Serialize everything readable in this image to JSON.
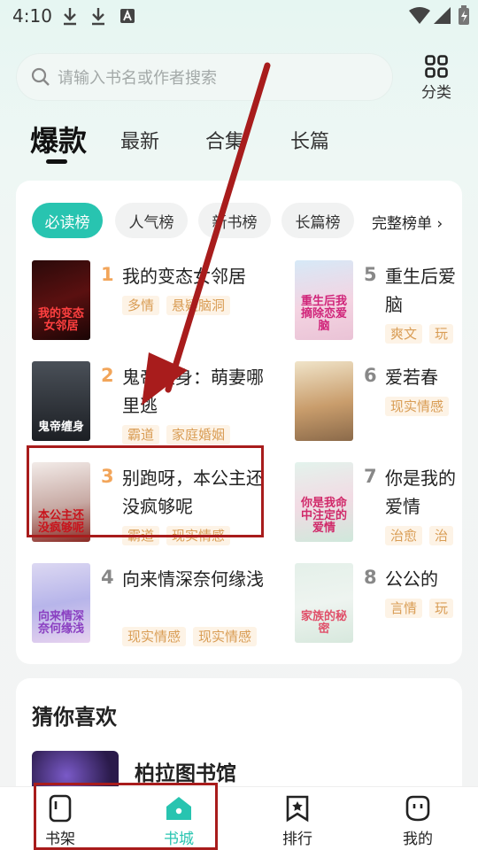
{
  "status_bar": {
    "time": "4:10"
  },
  "search": {
    "placeholder": "请输入书名或作者搜索"
  },
  "category": {
    "label": "分类"
  },
  "tabs": [
    {
      "label": "爆款",
      "active": true
    },
    {
      "label": "最新"
    },
    {
      "label": "合集"
    },
    {
      "label": "长篇"
    }
  ],
  "rank_chips": [
    {
      "label": "必读榜",
      "active": true
    },
    {
      "label": "人气榜"
    },
    {
      "label": "新书榜"
    },
    {
      "label": "长篇榜"
    }
  ],
  "rank_more": "完整榜单",
  "books": [
    {
      "rank": "1",
      "title": "我的变态女邻居",
      "tags": [
        "多情",
        "悬疑脑洞"
      ],
      "cover_text": "我的变态女邻居"
    },
    {
      "rank": "2",
      "title": "鬼帝缠身：萌妻哪里逃",
      "tags": [
        "霸道",
        "家庭婚姻"
      ],
      "cover_text": "鬼帝缠身"
    },
    {
      "rank": "3",
      "title": "别跑呀，本公主还没疯够呢",
      "tags": [
        "霸道",
        "现实情感"
      ],
      "cover_text": "本公主还没疯够呢"
    },
    {
      "rank": "4",
      "title": "向来情深奈何缘浅",
      "tags": [
        "现实情感",
        "现实情感"
      ],
      "cover_text": "向来情深奈何缘浅"
    },
    {
      "rank": "5",
      "title": "重生后爱脑",
      "tags": [
        "爽文",
        "玩"
      ],
      "cover_text": "重生后我摘除恋爱脑"
    },
    {
      "rank": "6",
      "title": "爱若春",
      "tags": [
        "现实情感"
      ],
      "cover_text": ""
    },
    {
      "rank": "7",
      "title": "你是我的爱情",
      "tags": [
        "治愈",
        "治"
      ],
      "cover_text": "你是我命中注定的爱情"
    },
    {
      "rank": "8",
      "title": "公公的",
      "tags": [
        "言情",
        "玩"
      ],
      "cover_text": "家族的秘密"
    }
  ],
  "guess": {
    "title": "猜你喜欢",
    "book_title": "柏拉图书馆"
  },
  "bottom_nav": [
    {
      "label": "书架",
      "icon": "bookshelf-icon"
    },
    {
      "label": "书城",
      "icon": "bookstore-icon",
      "active": true
    },
    {
      "label": "排行",
      "icon": "ranking-icon"
    },
    {
      "label": "我的",
      "icon": "profile-icon"
    }
  ],
  "colors": {
    "accent": "#28c4b0",
    "tag_bg": "#fdf3e6",
    "tag_text": "#d99d55",
    "annotation": "#a81c1c"
  }
}
